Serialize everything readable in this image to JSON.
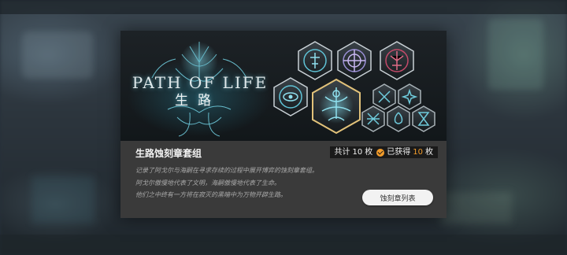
{
  "banner": {
    "logo_en": "PATH OF LIFE",
    "logo_cn": "生路",
    "badge_label": "PATH OF LIFE",
    "badge_icons": [
      "totem-icon",
      "constellation-icon",
      "tree-icon",
      "eye-icon",
      "goddess-icon",
      "pinwheel-icon",
      "star-icon",
      "crossed-swords-icon",
      "fire-icon",
      "hourglass-icon"
    ]
  },
  "set": {
    "title": "生路蚀刻章套组",
    "count_prefix": "共计",
    "total": "10",
    "unit1": "枚",
    "obtained_label": "已获得",
    "obtained": "10",
    "unit2": "枚",
    "desc_lines": [
      "记录了阿戈尔与海嗣在寻求存续的过程中展开博弈的蚀刻章套组。",
      "阿戈尔傲慢地代表了文明，海嗣傲慢地代表了生命。",
      "他们之中终有一方将在寂灭的黑暗中为万物开辟生路。"
    ],
    "list_button": "蚀刻章列表"
  },
  "colors": {
    "accent": "#f39c2b",
    "modal_bg": "#3a3a3a",
    "glow": "#7fd6e6"
  }
}
